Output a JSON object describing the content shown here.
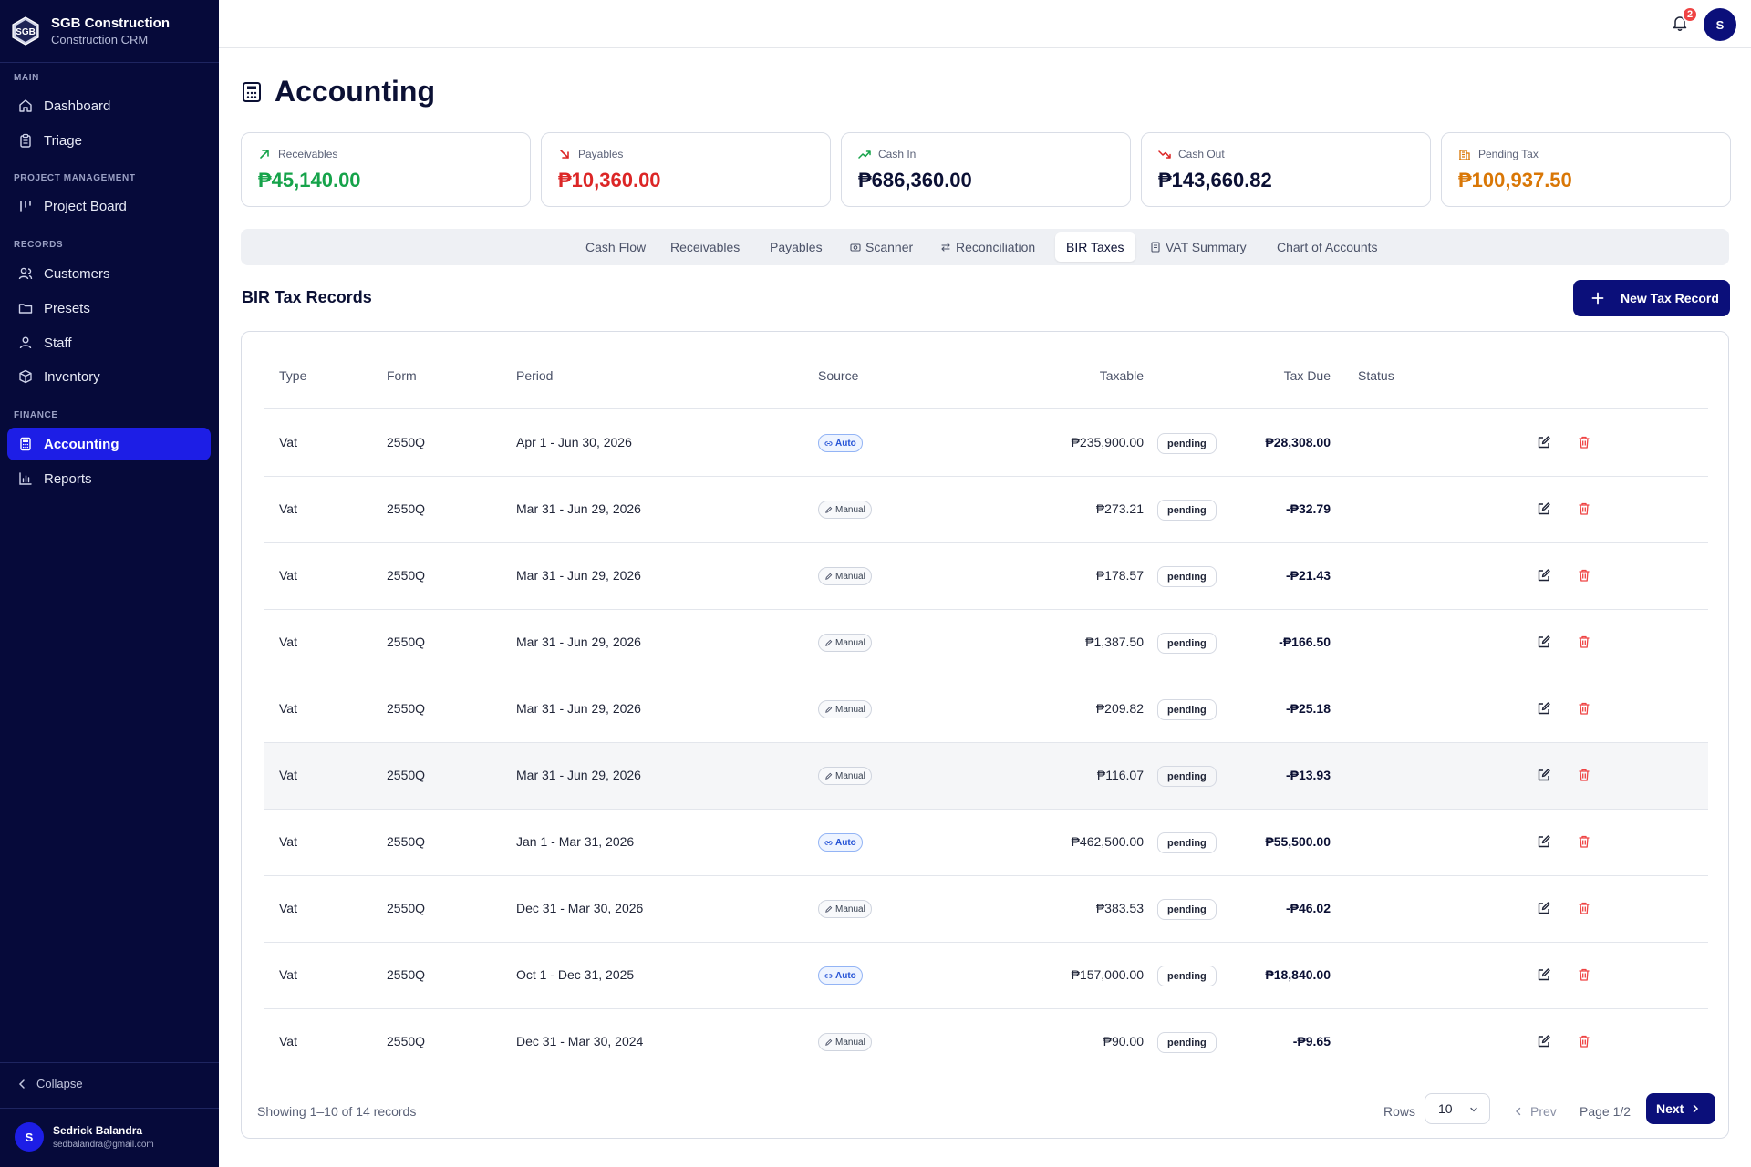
{
  "brand": {
    "logo_text": "SGB",
    "title": "SGB Construction",
    "subtitle": "Construction CRM"
  },
  "sidebar": {
    "sections": [
      {
        "label": "MAIN"
      },
      {
        "label": "PROJECT MANAGEMENT"
      },
      {
        "label": "RECORDS"
      },
      {
        "label": "FINANCE"
      }
    ],
    "items": [
      {
        "label": "Dashboard",
        "icon": "home-icon"
      },
      {
        "label": "Triage",
        "icon": "clipboard-icon"
      },
      {
        "label": "Project Board",
        "icon": "kanban-icon"
      },
      {
        "label": "Customers",
        "icon": "users-icon"
      },
      {
        "label": "Presets",
        "icon": "folder-icon"
      },
      {
        "label": "Staff",
        "icon": "staff-icon"
      },
      {
        "label": "Inventory",
        "icon": "box-icon"
      },
      {
        "label": "Accounting",
        "icon": "calculator-icon",
        "active": true
      },
      {
        "label": "Reports",
        "icon": "bar-chart-icon"
      }
    ],
    "collapse_label": "Collapse",
    "user": {
      "initial": "S",
      "name": "Sedrick Balandra",
      "email": "sedbalandra@gmail.com"
    }
  },
  "topbar": {
    "notification_count": "2",
    "avatar_initial": "S"
  },
  "page": {
    "title": "Accounting"
  },
  "stats": [
    {
      "label": "Receivables",
      "value": "₱45,140.00",
      "color": "#16a34a",
      "icon": "arrow-up-right-icon"
    },
    {
      "label": "Payables",
      "value": "₱10,360.00",
      "color": "#dc2626",
      "icon": "arrow-down-right-icon"
    },
    {
      "label": "Cash In",
      "value": "₱686,360.00",
      "color": "#0b1034",
      "icon": "trending-up-icon"
    },
    {
      "label": "Cash Out",
      "value": "₱143,660.82",
      "color": "#0b1034",
      "icon": "trending-down-icon"
    },
    {
      "label": "Pending Tax",
      "value": "₱100,937.50",
      "color": "#d97706",
      "icon": "building-icon"
    }
  ],
  "tabs": [
    {
      "label": "Cash Flow"
    },
    {
      "label": "Receivables"
    },
    {
      "label": "Payables"
    },
    {
      "label": "Scanner",
      "icon": "camera-icon"
    },
    {
      "label": "Reconciliation",
      "icon": "swap-icon"
    },
    {
      "label": "BIR Taxes",
      "active": true
    },
    {
      "label": "VAT Summary",
      "icon": "receipt-icon"
    },
    {
      "label": "Chart of Accounts"
    }
  ],
  "section": {
    "title": "BIR Tax Records",
    "new_button": "New Tax Record"
  },
  "table": {
    "columns": [
      "Type",
      "Form",
      "Period",
      "Source",
      "Taxable",
      "Tax Due",
      "Status"
    ],
    "rows": [
      {
        "type": "Vat",
        "form": "2550Q",
        "period": "Apr 1 - Jun 30, 2026",
        "source": "Auto",
        "taxable": "₱235,900.00",
        "tax_due": "₱28,308.00",
        "status": "pending"
      },
      {
        "type": "Vat",
        "form": "2550Q",
        "period": "Mar 31 - Jun 29, 2026",
        "source": "Manual",
        "taxable": "₱273.21",
        "tax_due": "-₱32.79",
        "status": "pending"
      },
      {
        "type": "Vat",
        "form": "2550Q",
        "period": "Mar 31 - Jun 29, 2026",
        "source": "Manual",
        "taxable": "₱178.57",
        "tax_due": "-₱21.43",
        "status": "pending"
      },
      {
        "type": "Vat",
        "form": "2550Q",
        "period": "Mar 31 - Jun 29, 2026",
        "source": "Manual",
        "taxable": "₱1,387.50",
        "tax_due": "-₱166.50",
        "status": "pending"
      },
      {
        "type": "Vat",
        "form": "2550Q",
        "period": "Mar 31 - Jun 29, 2026",
        "source": "Manual",
        "taxable": "₱209.82",
        "tax_due": "-₱25.18",
        "status": "pending"
      },
      {
        "type": "Vat",
        "form": "2550Q",
        "period": "Mar 31 - Jun 29, 2026",
        "source": "Manual",
        "taxable": "₱116.07",
        "tax_due": "-₱13.93",
        "status": "pending"
      },
      {
        "type": "Vat",
        "form": "2550Q",
        "period": "Jan 1 - Mar 31, 2026",
        "source": "Auto",
        "taxable": "₱462,500.00",
        "tax_due": "₱55,500.00",
        "status": "pending"
      },
      {
        "type": "Vat",
        "form": "2550Q",
        "period": "Dec 31 - Mar 30, 2026",
        "source": "Manual",
        "taxable": "₱383.53",
        "tax_due": "-₱46.02",
        "status": "pending"
      },
      {
        "type": "Vat",
        "form": "2550Q",
        "period": "Oct 1 - Dec 31, 2025",
        "source": "Auto",
        "taxable": "₱157,000.00",
        "tax_due": "₱18,840.00",
        "status": "pending"
      },
      {
        "type": "Vat",
        "form": "2550Q",
        "period": "Dec 31 - Mar 30, 2024",
        "source": "Manual",
        "taxable": "₱90.00",
        "tax_due": "-₱9.65",
        "status": "pending"
      }
    ]
  },
  "footer": {
    "showing": "Showing 1–10 of 14 records",
    "rows_label": "Rows",
    "rows_value": "10",
    "prev": "Prev",
    "page": "Page 1/2",
    "next": "Next"
  }
}
